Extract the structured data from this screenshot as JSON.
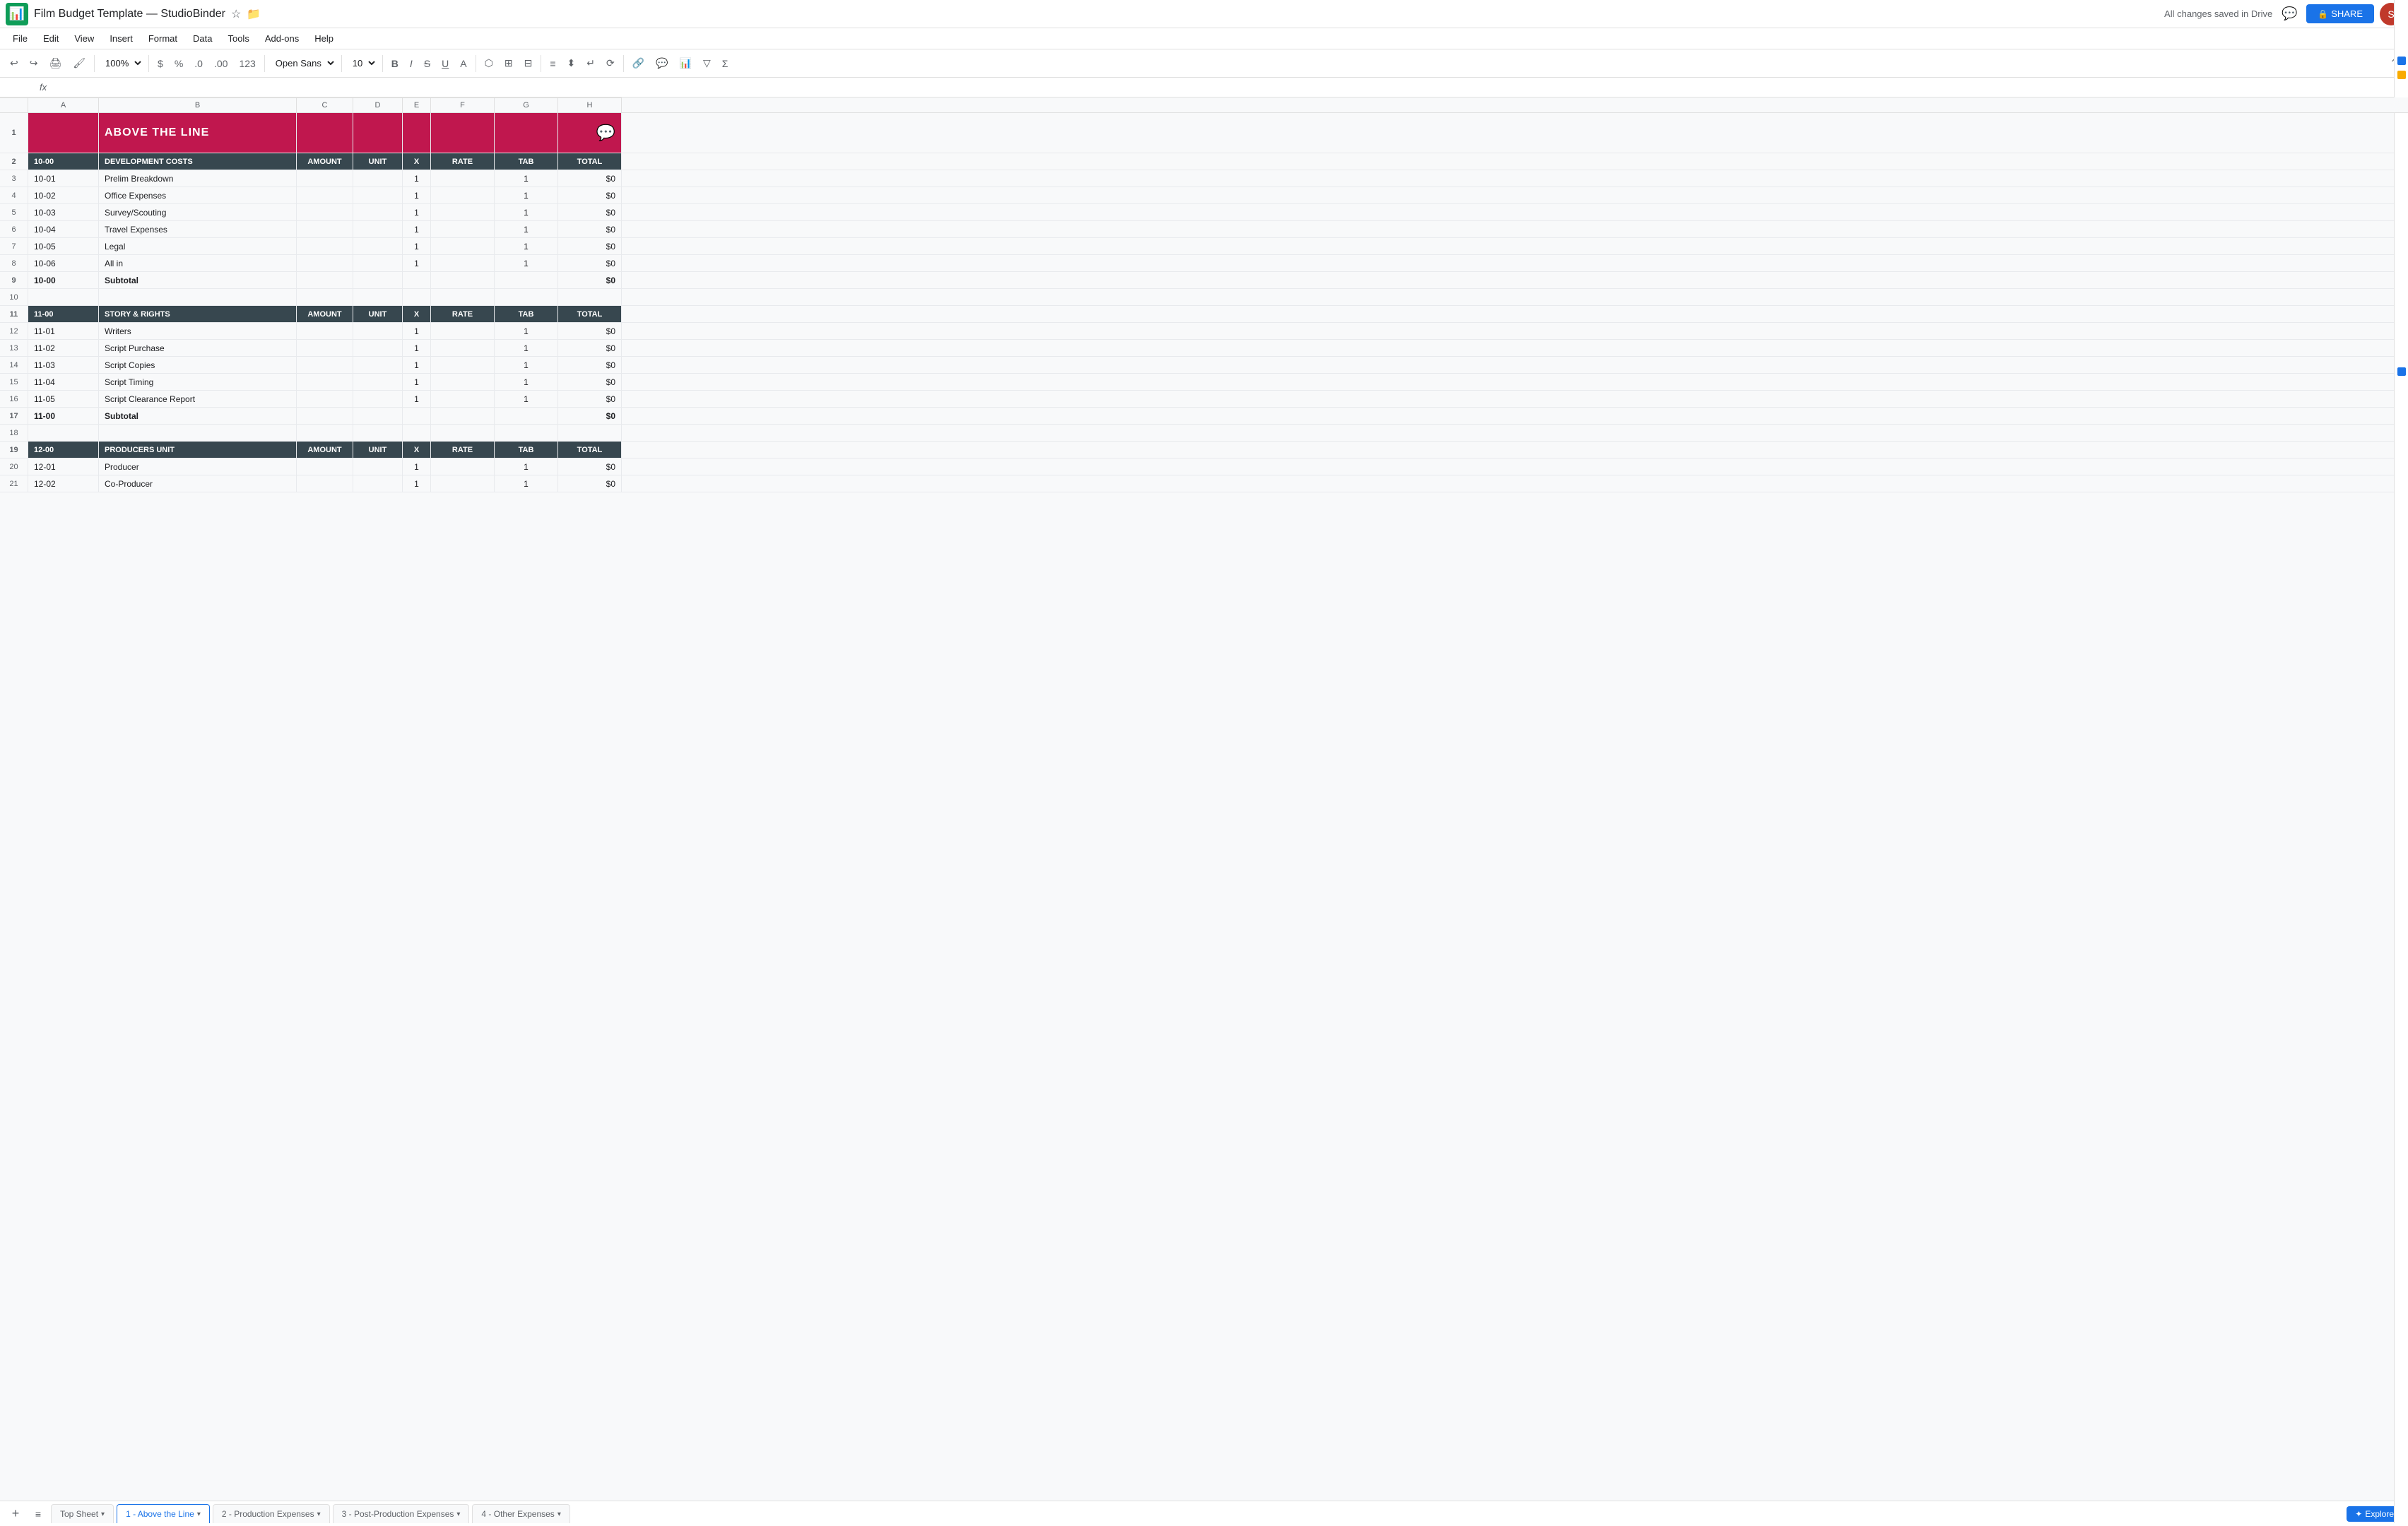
{
  "app": {
    "icon": "📊",
    "title": "Film Budget Template — StudioBinder",
    "saved_text": "All changes saved in Drive",
    "share_label": "SHARE",
    "avatar_initials": "S"
  },
  "menu": {
    "items": [
      "File",
      "Edit",
      "View",
      "Insert",
      "Format",
      "Data",
      "Tools",
      "Add-ons",
      "Help"
    ]
  },
  "toolbar": {
    "zoom": "100%",
    "font": "Open Sans",
    "font_size": "10",
    "currency": "$",
    "percent": "%"
  },
  "formula_bar": {
    "cell_ref": "",
    "fx": "fx"
  },
  "columns": {
    "headers": [
      "",
      "A",
      "B",
      "C",
      "D",
      "E",
      "F",
      "G",
      "H"
    ]
  },
  "header_row": {
    "title": "ABOVE THE LINE",
    "comment_icon": "💬"
  },
  "sections": [
    {
      "type": "section_header",
      "row_num": "2",
      "code": "10-00",
      "name": "DEVELOPMENT COSTS",
      "amount": "AMOUNT",
      "unit": "UNIT",
      "x": "X",
      "rate": "RATE",
      "tab": "TAB",
      "total": "TOTAL"
    },
    {
      "type": "data",
      "row_num": "3",
      "code": "10-01",
      "name": "Prelim Breakdown",
      "amount": "",
      "unit": "",
      "x": "1",
      "rate": "",
      "tab": "1",
      "total": "$0"
    },
    {
      "type": "data",
      "row_num": "4",
      "code": "10-02",
      "name": "Office Expenses",
      "amount": "",
      "unit": "",
      "x": "1",
      "rate": "",
      "tab": "1",
      "total": "$0"
    },
    {
      "type": "data",
      "row_num": "5",
      "code": "10-03",
      "name": "Survey/Scouting",
      "amount": "",
      "unit": "",
      "x": "1",
      "rate": "",
      "tab": "1",
      "total": "$0"
    },
    {
      "type": "data",
      "row_num": "6",
      "code": "10-04",
      "name": "Travel Expenses",
      "amount": "",
      "unit": "",
      "x": "1",
      "rate": "",
      "tab": "1",
      "total": "$0"
    },
    {
      "type": "data",
      "row_num": "7",
      "code": "10-05",
      "name": "Legal",
      "amount": "",
      "unit": "",
      "x": "1",
      "rate": "",
      "tab": "1",
      "total": "$0"
    },
    {
      "type": "data",
      "row_num": "8",
      "code": "10-06",
      "name": "All in",
      "amount": "",
      "unit": "",
      "x": "1",
      "rate": "",
      "tab": "1",
      "total": "$0"
    },
    {
      "type": "subtotal",
      "row_num": "9",
      "code": "10-00",
      "name": "Subtotal",
      "amount": "",
      "unit": "",
      "x": "",
      "rate": "",
      "tab": "",
      "total": "$0"
    },
    {
      "type": "empty",
      "row_num": "10",
      "code": "",
      "name": "",
      "amount": "",
      "unit": "",
      "x": "",
      "rate": "",
      "tab": "",
      "total": ""
    },
    {
      "type": "section_header",
      "row_num": "11",
      "code": "11-00",
      "name": "STORY & RIGHTS",
      "amount": "AMOUNT",
      "unit": "UNIT",
      "x": "X",
      "rate": "RATE",
      "tab": "TAB",
      "total": "TOTAL"
    },
    {
      "type": "data",
      "row_num": "12",
      "code": "11-01",
      "name": "Writers",
      "amount": "",
      "unit": "",
      "x": "1",
      "rate": "",
      "tab": "1",
      "total": "$0"
    },
    {
      "type": "data",
      "row_num": "13",
      "code": "11-02",
      "name": "Script Purchase",
      "amount": "",
      "unit": "",
      "x": "1",
      "rate": "",
      "tab": "1",
      "total": "$0"
    },
    {
      "type": "data",
      "row_num": "14",
      "code": "11-03",
      "name": "Script Copies",
      "amount": "",
      "unit": "",
      "x": "1",
      "rate": "",
      "tab": "1",
      "total": "$0"
    },
    {
      "type": "data",
      "row_num": "15",
      "code": "11-04",
      "name": "Script Timing",
      "amount": "",
      "unit": "",
      "x": "1",
      "rate": "",
      "tab": "1",
      "total": "$0"
    },
    {
      "type": "data",
      "row_num": "16",
      "code": "11-05",
      "name": "Script Clearance Report",
      "amount": "",
      "unit": "",
      "x": "1",
      "rate": "",
      "tab": "1",
      "total": "$0"
    },
    {
      "type": "subtotal",
      "row_num": "17",
      "code": "11-00",
      "name": "Subtotal",
      "amount": "",
      "unit": "",
      "x": "",
      "rate": "",
      "tab": "",
      "total": "$0"
    },
    {
      "type": "empty",
      "row_num": "18",
      "code": "",
      "name": "",
      "amount": "",
      "unit": "",
      "x": "",
      "rate": "",
      "tab": "",
      "total": ""
    },
    {
      "type": "section_header",
      "row_num": "19",
      "code": "12-00",
      "name": "PRODUCERS UNIT",
      "amount": "AMOUNT",
      "unit": "UNIT",
      "x": "X",
      "rate": "RATE",
      "tab": "TAB",
      "total": "TOTAL"
    },
    {
      "type": "data",
      "row_num": "20",
      "code": "12-01",
      "name": "Producer",
      "amount": "",
      "unit": "",
      "x": "1",
      "rate": "",
      "tab": "1",
      "total": "$0"
    },
    {
      "type": "data",
      "row_num": "21",
      "code": "12-02",
      "name": "Co-Producer",
      "amount": "",
      "unit": "",
      "x": "1",
      "rate": "",
      "tab": "1",
      "total": "$0"
    }
  ],
  "tabs": [
    {
      "label": "Top Sheet",
      "active": false
    },
    {
      "label": "1 - Above the Line",
      "active": true
    },
    {
      "label": "2 - Production Expenses",
      "active": false
    },
    {
      "label": "3 - Post-Production Expenses",
      "active": false
    },
    {
      "label": "4 - Other Expenses",
      "active": false
    }
  ],
  "bottom": {
    "add_sheet": "+",
    "menu_icon": "≡",
    "explore_label": "Explore"
  },
  "sidebar": {
    "comment_color": "#1a73e8",
    "bookmark_color": "#f9ab00",
    "check_color": "#1a73e8"
  }
}
